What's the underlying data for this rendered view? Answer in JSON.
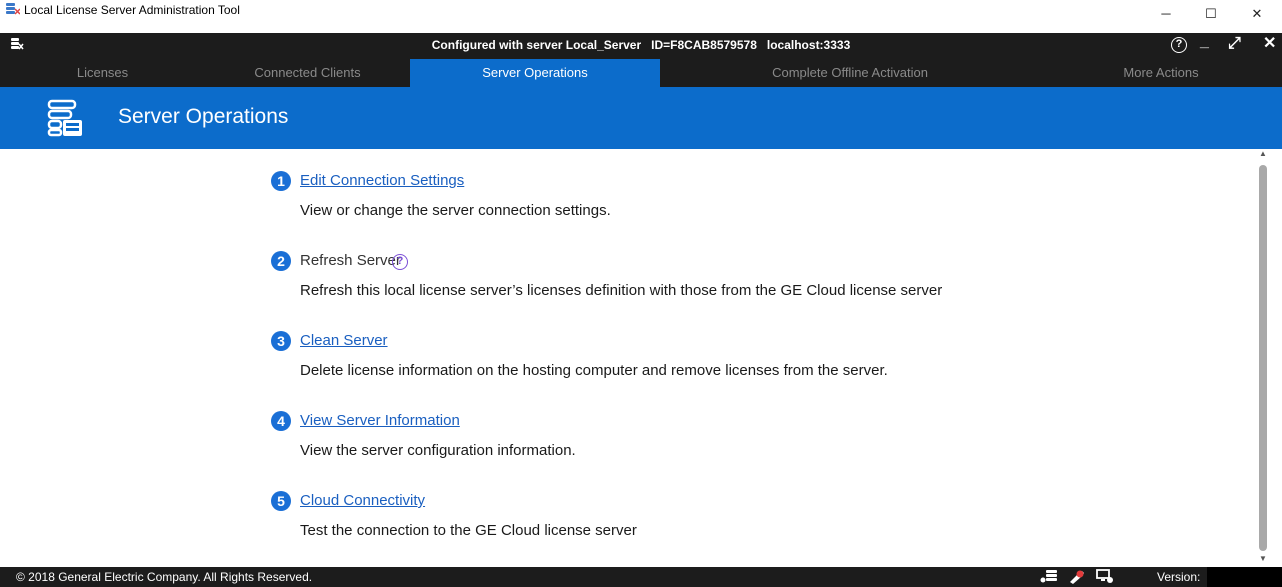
{
  "window": {
    "title": "Local License Server Administration Tool",
    "minimize_glyph": "─",
    "maximize_glyph": "☐",
    "close_glyph": "✕"
  },
  "appbar": {
    "server_info": "Configured with server Local_Server   ID=F8CAB8579578   localhost:3333",
    "help_glyph": "?",
    "minimize_glyph": "_",
    "expand_glyph": "⤢",
    "close_glyph": "✕"
  },
  "tabs": [
    {
      "label": "Licenses",
      "active": false
    },
    {
      "label": "Connected Clients",
      "active": false
    },
    {
      "label": "Server Operations",
      "active": true
    },
    {
      "label": "Complete Offline Activation",
      "active": false
    },
    {
      "label": "More Actions",
      "active": false
    }
  ],
  "header": {
    "title": "Server Operations",
    "icon": "server-database-icon"
  },
  "operations": [
    {
      "number": "1",
      "title": "Edit Connection Settings",
      "link": true,
      "description": "View or change the server connection settings."
    },
    {
      "number": "2",
      "title": "Refresh Server",
      "link": false,
      "help_glyph": "?",
      "description": "Refresh this local license server’s licenses definition with those from the GE Cloud license server"
    },
    {
      "number": "3",
      "title": "Clean Server",
      "link": true,
      "description": "Delete license information on the hosting computer and remove licenses from the server."
    },
    {
      "number": "4",
      "title": "View Server Information",
      "link": true,
      "description": "View the server configuration information."
    },
    {
      "number": "5",
      "title": "Cloud Connectivity",
      "link": true,
      "description": "Test the connection to the GE Cloud license server"
    }
  ],
  "footer": {
    "copyright": "© 2018 General Electric Company.  All Rights Reserved.",
    "version_label": "Version:",
    "version_value": "",
    "icons": [
      "server-status-icon",
      "license-key-icon",
      "clients-icon"
    ]
  },
  "colors": {
    "accent_blue": "#0c6ccb",
    "dark_bar": "#1c1c1c",
    "link": "#1a5fc0",
    "help": "#7b4fd6"
  }
}
